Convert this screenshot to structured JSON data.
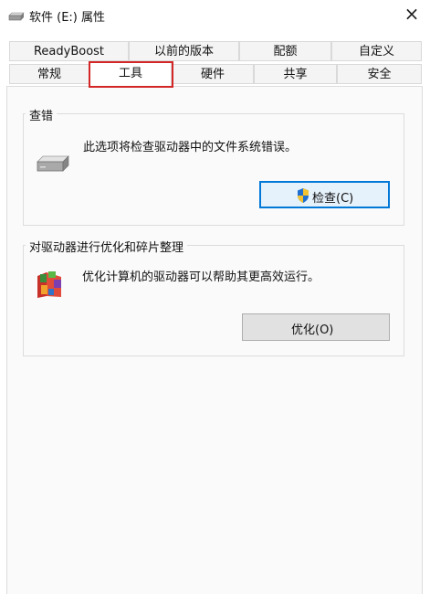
{
  "window": {
    "title": "软件 (E:) 属性",
    "close_glyph": "×"
  },
  "tabs": {
    "row1": [
      "ReadyBoost",
      "以前的版本",
      "配额",
      "自定义"
    ],
    "row2": [
      "常规",
      "工具",
      "硬件",
      "共享",
      "安全"
    ],
    "active": "工具"
  },
  "check_group": {
    "title": "查错",
    "description": "此选项将检查驱动器中的文件系统错误。",
    "button_label": "检查(C)",
    "icon": "drive-icon"
  },
  "optimize_group": {
    "title": "对驱动器进行优化和碎片整理",
    "description": "优化计算机的驱动器可以帮助其更高效运行。",
    "button_label": "优化(O)",
    "icon": "defrag-icon"
  },
  "colors": {
    "highlight_border": "#d32626",
    "focus_border": "#0078d7",
    "shield_blue": "#1e6fd0",
    "shield_yellow": "#f2c230"
  }
}
